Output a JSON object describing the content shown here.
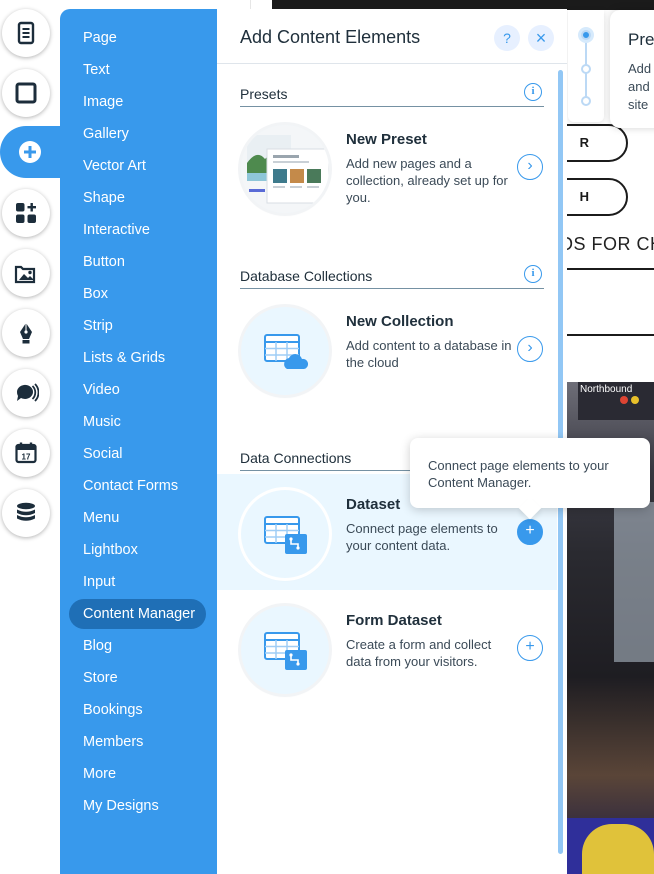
{
  "panel": {
    "title": "Add Content Elements",
    "help_label": "?",
    "close_label": "×"
  },
  "categories": [
    "Page",
    "Text",
    "Image",
    "Gallery",
    "Vector Art",
    "Shape",
    "Interactive",
    "Button",
    "Box",
    "Strip",
    "Lists & Grids",
    "Video",
    "Music",
    "Social",
    "Contact Forms",
    "Menu",
    "Lightbox",
    "Input",
    "Content Manager",
    "Blog",
    "Store",
    "Bookings",
    "Members",
    "More",
    "My Designs"
  ],
  "selected_category": "Content Manager",
  "sections": {
    "presets": {
      "title": "Presets",
      "info": "i"
    },
    "database_collections": {
      "title": "Database Collections",
      "info": "i"
    },
    "data_connections": {
      "title": "Data Connections"
    }
  },
  "items": {
    "new_preset": {
      "name": "New Preset",
      "description": "Add new pages and a collection, already set up for you.",
      "action": "›"
    },
    "new_collection": {
      "name": "New Collection",
      "description": "Add content to a database in the cloud",
      "action": "›"
    },
    "dataset": {
      "name": "Dataset",
      "description": "Connect page elements to your content data.",
      "action": "+"
    },
    "form_dataset": {
      "name": "Form Dataset",
      "description": "Create a form and collect data from your visitors.",
      "action": "+"
    }
  },
  "tooltip": {
    "text": "Connect page elements to your Content Manager."
  },
  "preview_card": {
    "title": "Pre",
    "lines": [
      "Add",
      "and",
      "site"
    ]
  },
  "site": {
    "pill1": "R",
    "pill2": "H",
    "heading": "DS FOR CH",
    "photo_sign": "Northbound"
  },
  "rail_icons": [
    "pages-icon",
    "background-icon",
    "add-icon",
    "app-market-icon",
    "media-icon",
    "pen-icon",
    "chat-icon",
    "bookings-calendar-icon",
    "database-icon"
  ],
  "colors": {
    "accent": "#3899ec",
    "selected_category": "#1f6fb6",
    "highlight_row": "#eaf7ff"
  }
}
